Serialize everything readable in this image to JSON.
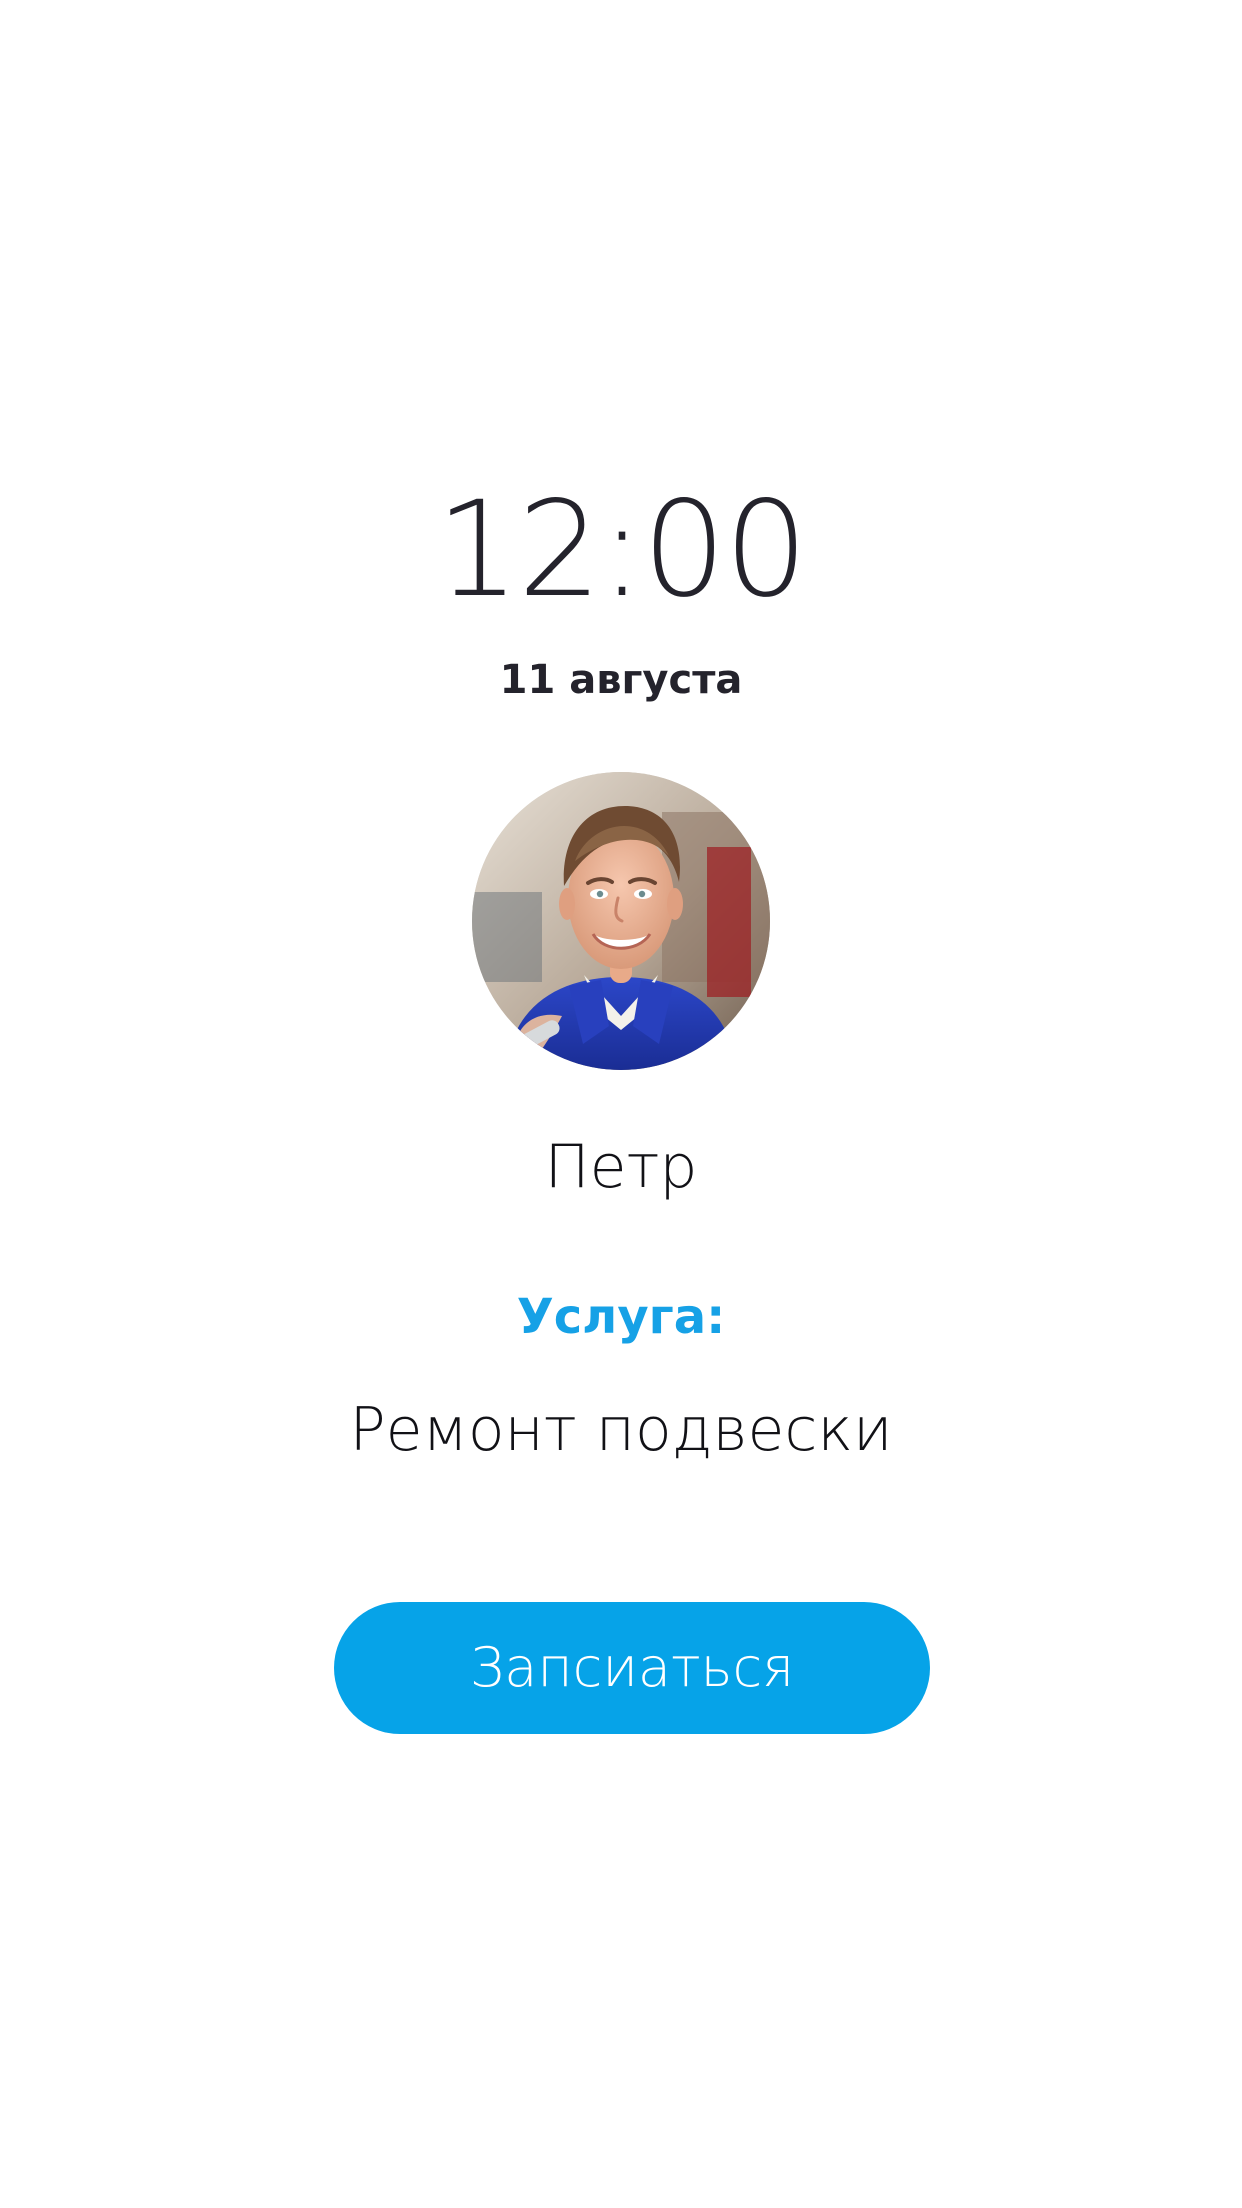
{
  "appointment": {
    "time": "12:00",
    "date": "11 августа"
  },
  "master": {
    "name": "Петр",
    "avatar_alt": "Фото мастера"
  },
  "service": {
    "label": "Услуга:",
    "value": "Ремонт подвески"
  },
  "actions": {
    "book_label": "Запсиаться"
  },
  "colors": {
    "accent": "#16a1e6",
    "button": "#06a3e8",
    "text_primary": "#24232c"
  }
}
